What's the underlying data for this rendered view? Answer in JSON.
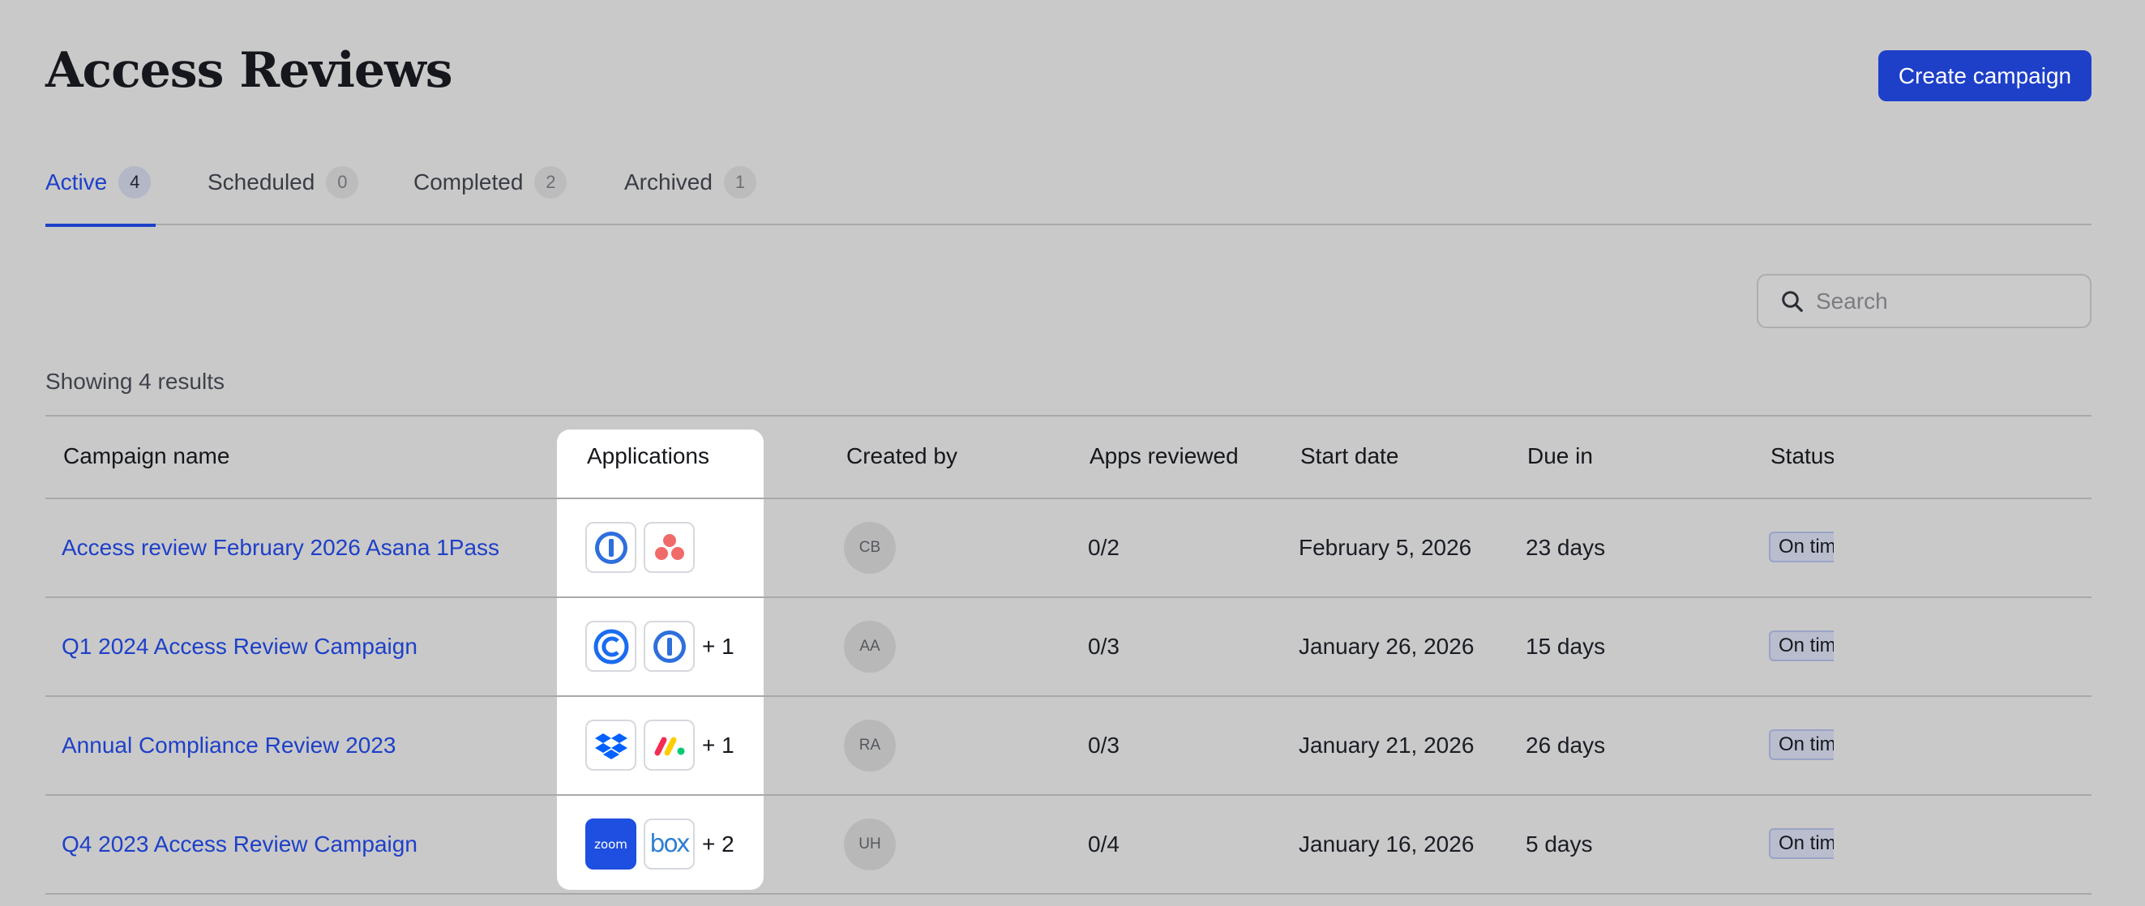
{
  "header": {
    "title": "Access Reviews",
    "create_label": "Create campaign"
  },
  "tabs": [
    {
      "label": "Active",
      "count": "4",
      "active": true
    },
    {
      "label": "Scheduled",
      "count": "0"
    },
    {
      "label": "Completed",
      "count": "2"
    },
    {
      "label": "Archived",
      "count": "1"
    }
  ],
  "search": {
    "placeholder": "Search",
    "value": ""
  },
  "results_text": "Showing 4 results",
  "table": {
    "columns": [
      "Campaign name",
      "Applications",
      "Created by",
      "Apps reviewed",
      "Start date",
      "Due in",
      "Status"
    ],
    "rows": [
      {
        "name": "Access review February 2026 Asana 1Pass",
        "apps": [
          "1password-icon",
          "asana-icon"
        ],
        "more": "",
        "created_by": "CB",
        "apps_reviewed": "0/2",
        "start_date": "February 5, 2026",
        "due_in": "23 days",
        "status": "On time"
      },
      {
        "name": "Q1 2024 Access Review Campaign",
        "apps": [
          "calendly-icon",
          "1password-icon"
        ],
        "more": "+ 1",
        "created_by": "AA",
        "apps_reviewed": "0/3",
        "start_date": "January 26, 2026",
        "due_in": "15 days",
        "status": "On time"
      },
      {
        "name": "Annual Compliance Review 2023",
        "apps": [
          "dropbox-icon",
          "monday-icon"
        ],
        "more": "+ 1",
        "created_by": "RA",
        "apps_reviewed": "0/3",
        "start_date": "January 21, 2026",
        "due_in": "26 days",
        "status": "On time"
      },
      {
        "name": "Q4 2023 Access Review Campaign",
        "apps": [
          "zoom-icon",
          "box-icon"
        ],
        "more": "+ 2",
        "created_by": "UH",
        "apps_reviewed": "0/4",
        "start_date": "January 16, 2026",
        "due_in": "5 days",
        "status": "On time"
      }
    ]
  },
  "app_labels": {
    "zoom": "zoom",
    "box": "box"
  },
  "colors": {
    "accent": "#1e40c8",
    "background": "#c9c9c9"
  }
}
